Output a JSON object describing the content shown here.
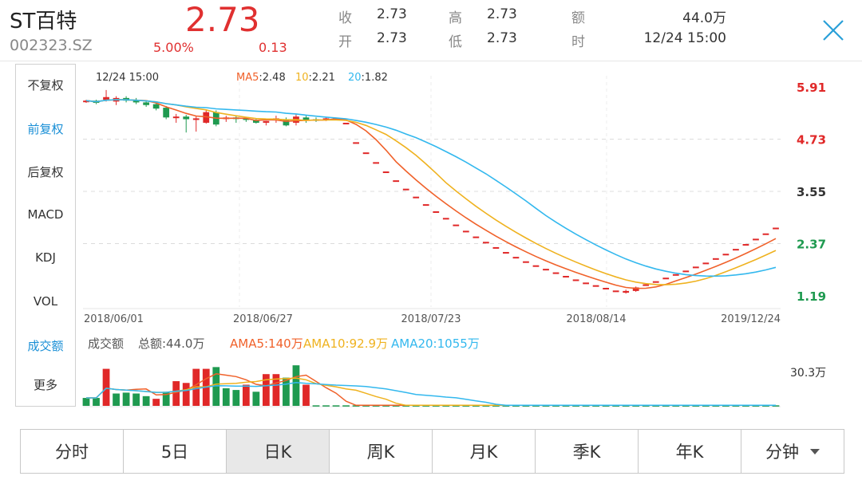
{
  "header": {
    "stock_name": "ST百特",
    "stock_code": "002323.SZ",
    "price": "2.73",
    "change_pct": "5.00%",
    "change": "0.13",
    "quote": {
      "close_label": "收",
      "close_value": "2.73",
      "open_label": "开",
      "open_value": "2.73",
      "high_label": "高",
      "high_value": "2.73",
      "low_label": "低",
      "low_value": "2.73",
      "amount_label": "额",
      "amount_value": "44.0万",
      "time_label": "时",
      "time_value": "12/24 15:00"
    }
  },
  "colors": {
    "up": "#e02828",
    "down": "#1f9a50",
    "ma5": "#f0612a",
    "ma10": "#efb21f",
    "ma20": "#33b8ee",
    "accent": "#1a8fd6"
  },
  "menu": [
    "不复权",
    "前复权",
    "后复权",
    "MACD",
    "KDJ",
    "VOL",
    "成交额",
    "更多"
  ],
  "menu_active_index": 1,
  "menu_accent_indices": [
    1,
    6
  ],
  "chart_data": {
    "type": "candlestick",
    "date_label": "12/24 15:00",
    "ma_legend": [
      {
        "name": "MA5",
        "value": "2.48",
        "color": "#f0612a"
      },
      {
        "name": "10",
        "value": "2.21",
        "color": "#efb21f"
      },
      {
        "name": "20",
        "value": "1.82",
        "color": "#33b8ee"
      }
    ],
    "y_ticks": [
      {
        "value": 5.91,
        "label": "5.91",
        "color": "#e02828"
      },
      {
        "value": 4.73,
        "label": "4.73",
        "color": "#e02828"
      },
      {
        "value": 3.55,
        "label": "3.55",
        "color": "#333333"
      },
      {
        "value": 2.37,
        "label": "2.37",
        "color": "#1f9a50"
      },
      {
        "value": 1.19,
        "label": "1.19",
        "color": "#1f9a50"
      }
    ],
    "x_labels": [
      "2018/06/01",
      "2018/06/27",
      "2018/07/23",
      "2018/08/14",
      "2019/12/24"
    ],
    "ylim": [
      1.19,
      5.91
    ],
    "candles": [
      [
        5.58,
        5.62,
        5.55,
        5.6
      ],
      [
        5.6,
        5.62,
        5.52,
        5.55
      ],
      [
        5.62,
        5.84,
        5.58,
        5.68
      ],
      [
        5.58,
        5.7,
        5.5,
        5.66
      ],
      [
        5.66,
        5.7,
        5.56,
        5.6
      ],
      [
        5.62,
        5.66,
        5.52,
        5.56
      ],
      [
        5.56,
        5.6,
        5.46,
        5.5
      ],
      [
        5.52,
        5.56,
        5.38,
        5.42
      ],
      [
        5.44,
        5.48,
        5.18,
        5.22
      ],
      [
        5.24,
        5.3,
        5.1,
        5.24
      ],
      [
        5.24,
        5.28,
        4.88,
        5.18
      ],
      [
        5.18,
        5.26,
        4.9,
        5.2
      ],
      [
        5.1,
        5.4,
        5.08,
        5.34
      ],
      [
        5.34,
        5.38,
        5.02,
        5.06
      ],
      [
        5.22,
        5.26,
        5.12,
        5.22
      ],
      [
        5.22,
        5.26,
        5.1,
        5.2
      ],
      [
        5.2,
        5.22,
        5.12,
        5.18
      ],
      [
        5.16,
        5.2,
        5.08,
        5.1
      ],
      [
        5.1,
        5.14,
        5.04,
        5.14
      ],
      [
        5.16,
        5.26,
        5.1,
        5.2
      ],
      [
        5.18,
        5.22,
        5.02,
        5.04
      ],
      [
        5.1,
        5.3,
        5.04,
        5.24
      ],
      [
        5.22,
        5.26,
        5.1,
        5.16
      ],
      [
        5.18,
        5.22,
        5.12,
        5.16
      ],
      [
        5.2,
        5.22,
        5.14,
        5.2
      ],
      [
        5.2,
        5.2,
        5.2,
        5.2
      ],
      [
        5.1,
        5.1,
        5.1,
        5.1
      ],
      [
        4.66,
        4.66,
        4.66,
        4.66
      ],
      [
        4.43,
        4.43,
        4.43,
        4.43
      ],
      [
        4.21,
        4.21,
        4.21,
        4.21
      ],
      [
        4.0,
        4.0,
        4.0,
        4.0
      ],
      [
        3.8,
        3.8,
        3.8,
        3.8
      ],
      [
        3.61,
        3.61,
        3.61,
        3.61
      ],
      [
        3.43,
        3.43,
        3.43,
        3.43
      ],
      [
        3.26,
        3.26,
        3.26,
        3.26
      ],
      [
        3.1,
        3.1,
        3.1,
        3.1
      ],
      [
        2.95,
        2.95,
        2.95,
        2.95
      ],
      [
        2.8,
        2.8,
        2.8,
        2.8
      ],
      [
        2.66,
        2.66,
        2.66,
        2.66
      ],
      [
        2.53,
        2.53,
        2.53,
        2.53
      ],
      [
        2.41,
        2.41,
        2.41,
        2.41
      ],
      [
        2.29,
        2.29,
        2.29,
        2.29
      ],
      [
        2.18,
        2.18,
        2.18,
        2.18
      ],
      [
        2.07,
        2.07,
        2.07,
        2.07
      ],
      [
        1.97,
        1.97,
        1.97,
        1.97
      ],
      [
        1.88,
        1.88,
        1.88,
        1.88
      ],
      [
        1.8,
        1.8,
        1.8,
        1.8
      ],
      [
        1.72,
        1.72,
        1.72,
        1.72
      ],
      [
        1.64,
        1.64,
        1.64,
        1.64
      ],
      [
        1.56,
        1.56,
        1.56,
        1.56
      ],
      [
        1.49,
        1.49,
        1.49,
        1.49
      ],
      [
        1.43,
        1.43,
        1.43,
        1.43
      ],
      [
        1.37,
        1.37,
        1.37,
        1.37
      ],
      [
        1.31,
        1.31,
        1.31,
        1.31
      ],
      [
        1.26,
        1.33,
        1.24,
        1.3
      ],
      [
        1.3,
        1.4,
        1.28,
        1.38
      ],
      [
        1.45,
        1.45,
        1.45,
        1.45
      ],
      [
        1.52,
        1.52,
        1.52,
        1.52
      ],
      [
        1.6,
        1.6,
        1.6,
        1.6
      ],
      [
        1.68,
        1.68,
        1.68,
        1.68
      ],
      [
        1.76,
        1.76,
        1.76,
        1.76
      ],
      [
        1.85,
        1.85,
        1.85,
        1.85
      ],
      [
        1.94,
        1.94,
        1.94,
        1.94
      ],
      [
        2.04,
        2.04,
        2.04,
        2.04
      ],
      [
        2.14,
        2.14,
        2.14,
        2.14
      ],
      [
        2.25,
        2.25,
        2.25,
        2.25
      ],
      [
        2.36,
        2.36,
        2.36,
        2.36
      ],
      [
        2.48,
        2.48,
        2.48,
        2.48
      ],
      [
        2.6,
        2.6,
        2.6,
        2.6
      ],
      [
        2.73,
        2.73,
        2.73,
        2.73
      ]
    ],
    "volume": {
      "label": "成交额",
      "total_label": "总额:",
      "total_value": "44.0万",
      "legend": [
        {
          "name": "AMA5",
          "value": "140万",
          "color": "#f0612a"
        },
        {
          "name": "AMA10",
          "value": "92.9万",
          "color": "#efb21f"
        },
        {
          "name": "AMA20",
          "value": "1055万",
          "color": "#33b8ee"
        }
      ],
      "max_label": "30.3万",
      "max": 30.3,
      "bars": [
        [
          4.5,
          0
        ],
        [
          4.5,
          0
        ],
        [
          21,
          1
        ],
        [
          7,
          0
        ],
        [
          7.5,
          0
        ],
        [
          7,
          0
        ],
        [
          5.5,
          0
        ],
        [
          4,
          1
        ],
        [
          8,
          0
        ],
        [
          14,
          1
        ],
        [
          13,
          1
        ],
        [
          21,
          1
        ],
        [
          21,
          1
        ],
        [
          22,
          0
        ],
        [
          10,
          0
        ],
        [
          9,
          0
        ],
        [
          12,
          1
        ],
        [
          8,
          0
        ],
        [
          18,
          1
        ],
        [
          18,
          1
        ],
        [
          16,
          0
        ],
        [
          23,
          0
        ],
        [
          12,
          1
        ],
        [
          0.3,
          0
        ],
        [
          0.3,
          0
        ],
        [
          0.3,
          0
        ],
        [
          0.3,
          0
        ],
        [
          0.3,
          0
        ],
        [
          0.3,
          0
        ],
        [
          0.3,
          0
        ],
        [
          0.3,
          0
        ],
        [
          0.3,
          0
        ],
        [
          0.3,
          0
        ],
        [
          0.3,
          0
        ],
        [
          0.3,
          0
        ],
        [
          0.3,
          0
        ],
        [
          0.3,
          0
        ],
        [
          0.3,
          0
        ],
        [
          0.3,
          0
        ],
        [
          0.3,
          0
        ],
        [
          0.3,
          0
        ],
        [
          0.3,
          0
        ],
        [
          0.3,
          0
        ],
        [
          0.3,
          0
        ],
        [
          0.3,
          0
        ],
        [
          0.3,
          0
        ],
        [
          0.3,
          0
        ],
        [
          0.3,
          0
        ],
        [
          0.3,
          0
        ],
        [
          0.3,
          0
        ],
        [
          0.3,
          0
        ],
        [
          0.3,
          0
        ],
        [
          0.3,
          0
        ],
        [
          0.3,
          0
        ],
        [
          0.3,
          0
        ],
        [
          0.3,
          0
        ],
        [
          0.3,
          0
        ],
        [
          0.3,
          0
        ],
        [
          0.3,
          0
        ],
        [
          0.3,
          0
        ],
        [
          0.3,
          0
        ],
        [
          0.3,
          0
        ],
        [
          0.3,
          0
        ],
        [
          0.3,
          0
        ],
        [
          0.3,
          0
        ],
        [
          0.3,
          0
        ],
        [
          0.3,
          0
        ],
        [
          0.3,
          0
        ],
        [
          0.3,
          0
        ],
        [
          0.3,
          0
        ]
      ]
    }
  },
  "tabs": [
    "分时",
    "5日",
    "日K",
    "周K",
    "月K",
    "季K",
    "年K",
    "分钟"
  ],
  "tab_active_index": 2
}
